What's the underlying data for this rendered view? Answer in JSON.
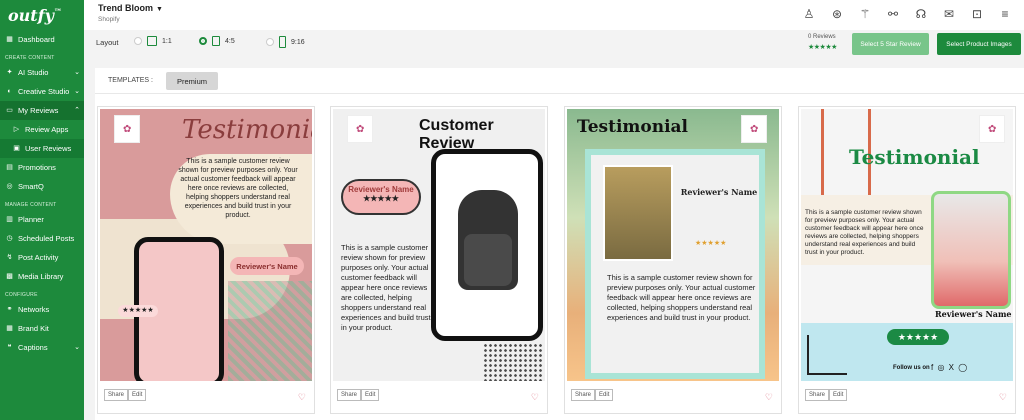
{
  "brand": {
    "logo": "outfy",
    "tm": "™"
  },
  "header": {
    "store_name": "Trend Bloom",
    "store_platform": "Shopify"
  },
  "sidebar": {
    "dashboard": "Dashboard",
    "section_create": "CREATE CONTENT",
    "ai_studio": "AI Studio",
    "creative_studio": "Creative Studio",
    "my_reviews": "My Reviews",
    "review_apps": "Review Apps",
    "user_reviews": "User Reviews",
    "promotions": "Promotions",
    "smartq": "SmartQ",
    "section_manage": "MANAGE CONTENT",
    "planner": "Planner",
    "scheduled_posts": "Scheduled Posts",
    "post_activity": "Post Activity",
    "media_library": "Media Library",
    "section_configure": "CONFIGURE",
    "networks": "Networks",
    "brand_kit": "Brand Kit",
    "captions": "Captions"
  },
  "layout": {
    "label": "Layout",
    "options": [
      "1:1",
      "4:5",
      "9:16"
    ],
    "selected": "4:5"
  },
  "reviews": {
    "count": "0 Reviews",
    "stars": "★★★★★"
  },
  "buttons": {
    "select_5_star": "Select 5 Star Review",
    "select_product_images": "Select Product Images"
  },
  "templates": {
    "label": "TEMPLATES :",
    "tab": "Premium"
  },
  "cards": [
    {
      "title": "Testimonial",
      "text": "This is a sample customer review shown for preview purposes only. Your actual customer feedback will appear here once reviews are collected, helping shoppers understand real experiences and build trust in your product.",
      "name": "Reviewer's Name",
      "stars": "★★★★★",
      "share": "Share",
      "edit": "Edit"
    },
    {
      "title": "Customer Review",
      "text": "This is a sample customer review shown for preview purposes only. Your actual customer feedback will appear here once reviews are collected, helping shoppers understand real experiences and build trust in your product.",
      "name": "Reviewer's Name",
      "stars": "★★★★★",
      "share": "Share",
      "edit": "Edit"
    },
    {
      "title": "Testimonial",
      "text": "This is a sample customer review shown for preview purposes only. Your actual customer feedback will appear here once reviews are collected, helping shoppers understand real experiences and build trust in your product.",
      "name": "Reviewer's Name",
      "stars": "★★★★★",
      "share": "Share",
      "edit": "Edit"
    },
    {
      "title": "Testimonial",
      "text": "This is a sample customer review shown for preview purposes only. Your actual customer feedback will appear here once reviews are collected, helping shoppers understand real experiences and build trust in your product.",
      "name": "Reviewer's Name",
      "stars": "★★★★★",
      "follow": "Follow us on",
      "social": "f ◎ X ◯",
      "share": "Share",
      "edit": "Edit"
    }
  ],
  "colors": {
    "brand_green": "#1d8a3c",
    "light_green": "#78c58a",
    "heart": "#d9687a"
  }
}
